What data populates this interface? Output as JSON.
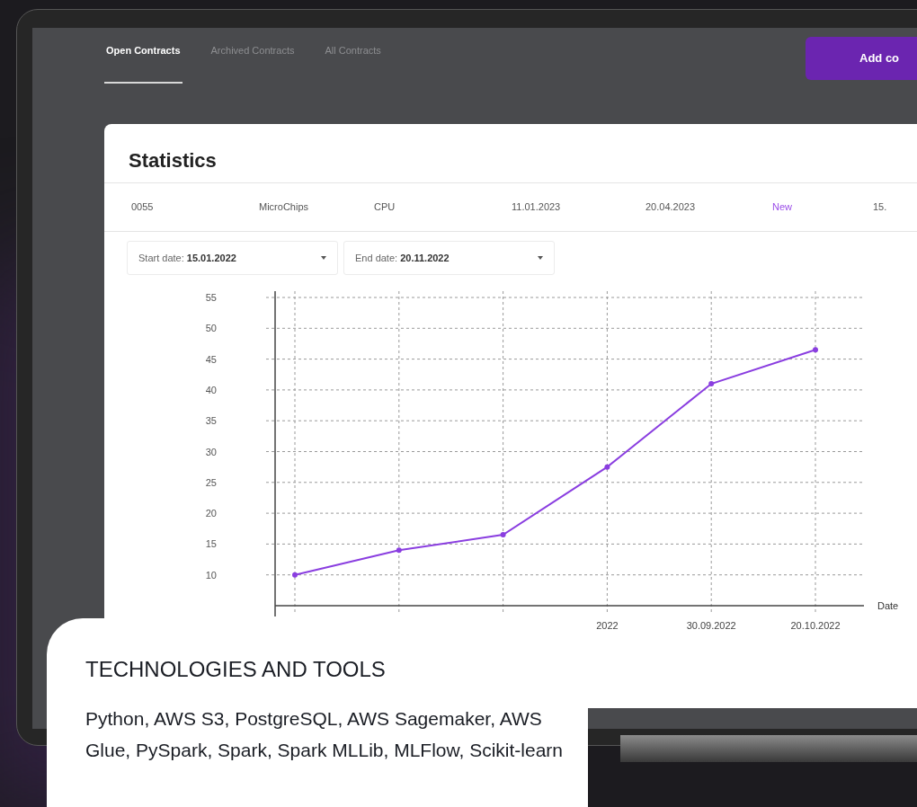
{
  "tabs": [
    {
      "label": "Open Contracts",
      "selected": true
    },
    {
      "label": "Archived Contracts",
      "selected": false
    },
    {
      "label": "All Contracts",
      "selected": false
    }
  ],
  "add_button": "Add co",
  "modal": {
    "title": "Statistics",
    "row": [
      {
        "text": "0055",
        "kind": "text"
      },
      {
        "text": "MicroChips",
        "kind": "text"
      },
      {
        "text": "CPU",
        "kind": "text"
      },
      {
        "text": "11.01.2023",
        "kind": "text"
      },
      {
        "text": "20.04.2023",
        "kind": "text"
      },
      {
        "text": "New",
        "kind": "status"
      },
      {
        "text": "15.",
        "kind": "text"
      }
    ],
    "filters": [
      {
        "label": "Start date:",
        "value": "15.01.2022"
      },
      {
        "label": "End date:",
        "value": "20.11.2022"
      }
    ],
    "chart_data": {
      "type": "line",
      "xlabel": "Date",
      "categories": [
        null,
        null,
        null,
        "2022",
        "30.09.2022",
        "20.10.2022"
      ],
      "grid": true,
      "series": [
        {
          "color": "#8a3ee0",
          "marker": true,
          "values": [
            10,
            14,
            16.5,
            27.5,
            41,
            46.5
          ]
        }
      ],
      "ylim": [
        5,
        55
      ],
      "yticks": [
        10,
        15,
        20,
        25,
        30,
        35,
        40,
        45,
        50,
        55
      ]
    }
  },
  "info_card": {
    "title": "TECHNOLOGIES AND TOOLS",
    "text": "Python, AWS S3, PostgreSQL, AWS Sagemaker, AWS Glue, PySpark, Spark, Spark MLLib, MLFlow, Scikit-learn"
  }
}
